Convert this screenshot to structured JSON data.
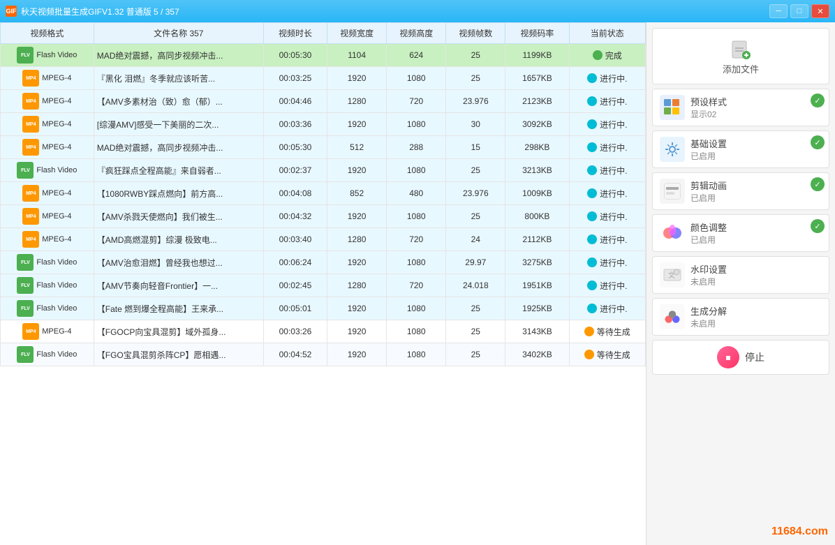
{
  "titleBar": {
    "title": "秋天视频批量生成GIFV1.32 普通版 5 / 357",
    "icon": "GIF",
    "controls": [
      "minimize",
      "maximize",
      "close"
    ]
  },
  "table": {
    "headers": [
      "视频格式",
      "文件名称 357",
      "视频时长",
      "视频宽度",
      "视频高度",
      "视频帧数",
      "视频码率",
      "当前状态"
    ],
    "rows": [
      {
        "format": "Flash Video",
        "formatType": "flv",
        "name": "MAD绝对震撼，高同步视频冲击...",
        "duration": "00:05:30",
        "width": "1104",
        "height": "624",
        "fps": "25",
        "bitrate": "1199KB",
        "status": "完成",
        "statusType": "complete",
        "rowType": "active"
      },
      {
        "format": "MPEG-4",
        "formatType": "mp4",
        "name": "『黑化 泪燃』冬季就应该听苦...",
        "duration": "00:03:25",
        "width": "1920",
        "height": "1080",
        "fps": "25",
        "bitrate": "1657KB",
        "status": "进行中.",
        "statusType": "progress",
        "rowType": "progress"
      },
      {
        "format": "MPEG-4",
        "formatType": "mp4",
        "name": "【AMV多素材治（致）愈（郁）...",
        "duration": "00:04:46",
        "width": "1280",
        "height": "720",
        "fps": "23.976",
        "bitrate": "2123KB",
        "status": "进行中.",
        "statusType": "progress",
        "rowType": "progress"
      },
      {
        "format": "MPEG-4",
        "formatType": "mp4",
        "name": "[综漫AMV]感受一下美丽的二次...",
        "duration": "00:03:36",
        "width": "1920",
        "height": "1080",
        "fps": "30",
        "bitrate": "3092KB",
        "status": "进行中.",
        "statusType": "progress",
        "rowType": "progress"
      },
      {
        "format": "MPEG-4",
        "formatType": "mp4",
        "name": "MAD绝对震撼，高同步视频冲击...",
        "duration": "00:05:30",
        "width": "512",
        "height": "288",
        "fps": "15",
        "bitrate": "298KB",
        "status": "进行中.",
        "statusType": "progress",
        "rowType": "progress"
      },
      {
        "format": "Flash Video",
        "formatType": "flv",
        "name": "『疯狂踩点全程高能』来自弱者...",
        "duration": "00:02:37",
        "width": "1920",
        "height": "1080",
        "fps": "25",
        "bitrate": "3213KB",
        "status": "进行中.",
        "statusType": "progress",
        "rowType": "progress"
      },
      {
        "format": "MPEG-4",
        "formatType": "mp4",
        "name": "【1080RWBY踩点燃向】前方高...",
        "duration": "00:04:08",
        "width": "852",
        "height": "480",
        "fps": "23.976",
        "bitrate": "1009KB",
        "status": "进行中.",
        "statusType": "progress",
        "rowType": "progress"
      },
      {
        "format": "MPEG-4",
        "formatType": "mp4",
        "name": "【AMV杀戮天使燃向】我们被生...",
        "duration": "00:04:32",
        "width": "1920",
        "height": "1080",
        "fps": "25",
        "bitrate": "800KB",
        "status": "进行中.",
        "statusType": "progress",
        "rowType": "progress"
      },
      {
        "format": "MPEG-4",
        "formatType": "mp4",
        "name": "【AMD高燃混剪】综漫  极致电...",
        "duration": "00:03:40",
        "width": "1280",
        "height": "720",
        "fps": "24",
        "bitrate": "2112KB",
        "status": "进行中.",
        "statusType": "progress",
        "rowType": "progress"
      },
      {
        "format": "Flash Video",
        "formatType": "flv",
        "name": "【AMV治愈泪燃】曾经我也想过...",
        "duration": "00:06:24",
        "width": "1920",
        "height": "1080",
        "fps": "29.97",
        "bitrate": "3275KB",
        "status": "进行中.",
        "statusType": "progress",
        "rowType": "progress"
      },
      {
        "format": "Flash Video",
        "formatType": "flv",
        "name": "【AMV节奏向轻音Frontier】一...",
        "duration": "00:02:45",
        "width": "1280",
        "height": "720",
        "fps": "24.018",
        "bitrate": "1951KB",
        "status": "进行中.",
        "statusType": "progress",
        "rowType": "progress"
      },
      {
        "format": "Flash Video",
        "formatType": "flv",
        "name": "【Fate 燃到爆全程高能】王来承...",
        "duration": "00:05:01",
        "width": "1920",
        "height": "1080",
        "fps": "25",
        "bitrate": "1925KB",
        "status": "进行中.",
        "statusType": "progress",
        "rowType": "progress"
      },
      {
        "format": "MPEG-4",
        "formatType": "mp4",
        "name": "【FGOCP向宝具混剪】域外孤身...",
        "duration": "00:03:26",
        "width": "1920",
        "height": "1080",
        "fps": "25",
        "bitrate": "3143KB",
        "status": "等待生成",
        "statusType": "waiting",
        "rowType": "normal"
      },
      {
        "format": "Flash Video",
        "formatType": "flv",
        "name": "【FGO宝具混剪杀阵CP】愿相遇...",
        "duration": "00:04:52",
        "width": "1920",
        "height": "1080",
        "fps": "25",
        "bitrate": "3402KB",
        "status": "等待生成",
        "statusType": "waiting",
        "rowType": "normal"
      }
    ]
  },
  "rightPanel": {
    "addFile": {
      "label": "添加文件"
    },
    "preset": {
      "label": "预设样式",
      "value": "显示02",
      "enabled": true
    },
    "basicSettings": {
      "label": "基础设置",
      "value": "已启用",
      "enabled": true
    },
    "clipAnimation": {
      "label": "剪辑动画",
      "value": "已启用",
      "enabled": true
    },
    "colorAdjust": {
      "label": "颜色调整",
      "value": "已启用",
      "enabled": true
    },
    "watermark": {
      "label": "水印设置",
      "value": "未启用",
      "enabled": false
    },
    "decompose": {
      "label": "生成分解",
      "value": "未启用",
      "enabled": false
    },
    "stopButton": {
      "label": "停止"
    }
  },
  "watermark": "11684.com"
}
